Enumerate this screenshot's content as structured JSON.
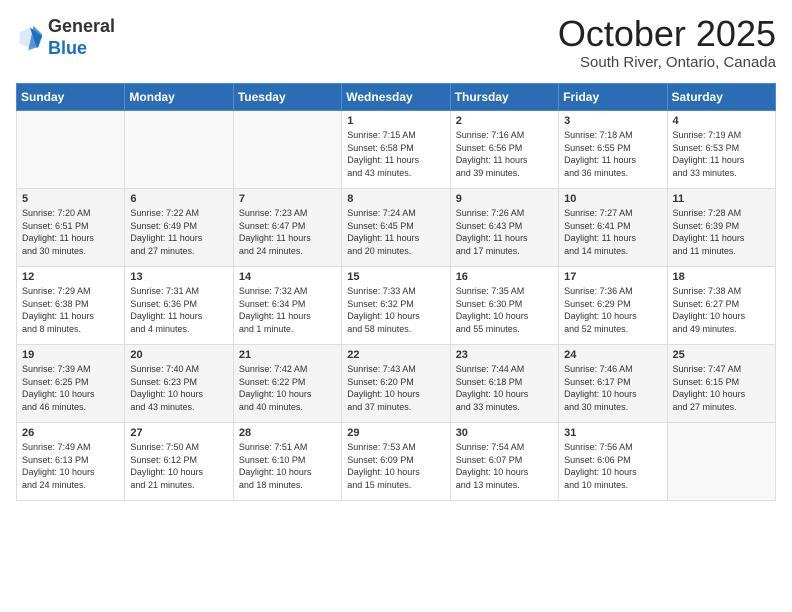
{
  "header": {
    "logo_general": "General",
    "logo_blue": "Blue",
    "month_title": "October 2025",
    "subtitle": "South River, Ontario, Canada"
  },
  "weekdays": [
    "Sunday",
    "Monday",
    "Tuesday",
    "Wednesday",
    "Thursday",
    "Friday",
    "Saturday"
  ],
  "weeks": [
    [
      {
        "day": "",
        "info": ""
      },
      {
        "day": "",
        "info": ""
      },
      {
        "day": "",
        "info": ""
      },
      {
        "day": "1",
        "info": "Sunrise: 7:15 AM\nSunset: 6:58 PM\nDaylight: 11 hours\nand 43 minutes."
      },
      {
        "day": "2",
        "info": "Sunrise: 7:16 AM\nSunset: 6:56 PM\nDaylight: 11 hours\nand 39 minutes."
      },
      {
        "day": "3",
        "info": "Sunrise: 7:18 AM\nSunset: 6:55 PM\nDaylight: 11 hours\nand 36 minutes."
      },
      {
        "day": "4",
        "info": "Sunrise: 7:19 AM\nSunset: 6:53 PM\nDaylight: 11 hours\nand 33 minutes."
      }
    ],
    [
      {
        "day": "5",
        "info": "Sunrise: 7:20 AM\nSunset: 6:51 PM\nDaylight: 11 hours\nand 30 minutes."
      },
      {
        "day": "6",
        "info": "Sunrise: 7:22 AM\nSunset: 6:49 PM\nDaylight: 11 hours\nand 27 minutes."
      },
      {
        "day": "7",
        "info": "Sunrise: 7:23 AM\nSunset: 6:47 PM\nDaylight: 11 hours\nand 24 minutes."
      },
      {
        "day": "8",
        "info": "Sunrise: 7:24 AM\nSunset: 6:45 PM\nDaylight: 11 hours\nand 20 minutes."
      },
      {
        "day": "9",
        "info": "Sunrise: 7:26 AM\nSunset: 6:43 PM\nDaylight: 11 hours\nand 17 minutes."
      },
      {
        "day": "10",
        "info": "Sunrise: 7:27 AM\nSunset: 6:41 PM\nDaylight: 11 hours\nand 14 minutes."
      },
      {
        "day": "11",
        "info": "Sunrise: 7:28 AM\nSunset: 6:39 PM\nDaylight: 11 hours\nand 11 minutes."
      }
    ],
    [
      {
        "day": "12",
        "info": "Sunrise: 7:29 AM\nSunset: 6:38 PM\nDaylight: 11 hours\nand 8 minutes."
      },
      {
        "day": "13",
        "info": "Sunrise: 7:31 AM\nSunset: 6:36 PM\nDaylight: 11 hours\nand 4 minutes."
      },
      {
        "day": "14",
        "info": "Sunrise: 7:32 AM\nSunset: 6:34 PM\nDaylight: 11 hours\nand 1 minute."
      },
      {
        "day": "15",
        "info": "Sunrise: 7:33 AM\nSunset: 6:32 PM\nDaylight: 10 hours\nand 58 minutes."
      },
      {
        "day": "16",
        "info": "Sunrise: 7:35 AM\nSunset: 6:30 PM\nDaylight: 10 hours\nand 55 minutes."
      },
      {
        "day": "17",
        "info": "Sunrise: 7:36 AM\nSunset: 6:29 PM\nDaylight: 10 hours\nand 52 minutes."
      },
      {
        "day": "18",
        "info": "Sunrise: 7:38 AM\nSunset: 6:27 PM\nDaylight: 10 hours\nand 49 minutes."
      }
    ],
    [
      {
        "day": "19",
        "info": "Sunrise: 7:39 AM\nSunset: 6:25 PM\nDaylight: 10 hours\nand 46 minutes."
      },
      {
        "day": "20",
        "info": "Sunrise: 7:40 AM\nSunset: 6:23 PM\nDaylight: 10 hours\nand 43 minutes."
      },
      {
        "day": "21",
        "info": "Sunrise: 7:42 AM\nSunset: 6:22 PM\nDaylight: 10 hours\nand 40 minutes."
      },
      {
        "day": "22",
        "info": "Sunrise: 7:43 AM\nSunset: 6:20 PM\nDaylight: 10 hours\nand 37 minutes."
      },
      {
        "day": "23",
        "info": "Sunrise: 7:44 AM\nSunset: 6:18 PM\nDaylight: 10 hours\nand 33 minutes."
      },
      {
        "day": "24",
        "info": "Sunrise: 7:46 AM\nSunset: 6:17 PM\nDaylight: 10 hours\nand 30 minutes."
      },
      {
        "day": "25",
        "info": "Sunrise: 7:47 AM\nSunset: 6:15 PM\nDaylight: 10 hours\nand 27 minutes."
      }
    ],
    [
      {
        "day": "26",
        "info": "Sunrise: 7:49 AM\nSunset: 6:13 PM\nDaylight: 10 hours\nand 24 minutes."
      },
      {
        "day": "27",
        "info": "Sunrise: 7:50 AM\nSunset: 6:12 PM\nDaylight: 10 hours\nand 21 minutes."
      },
      {
        "day": "28",
        "info": "Sunrise: 7:51 AM\nSunset: 6:10 PM\nDaylight: 10 hours\nand 18 minutes."
      },
      {
        "day": "29",
        "info": "Sunrise: 7:53 AM\nSunset: 6:09 PM\nDaylight: 10 hours\nand 15 minutes."
      },
      {
        "day": "30",
        "info": "Sunrise: 7:54 AM\nSunset: 6:07 PM\nDaylight: 10 hours\nand 13 minutes."
      },
      {
        "day": "31",
        "info": "Sunrise: 7:56 AM\nSunset: 6:06 PM\nDaylight: 10 hours\nand 10 minutes."
      },
      {
        "day": "",
        "info": ""
      }
    ]
  ]
}
